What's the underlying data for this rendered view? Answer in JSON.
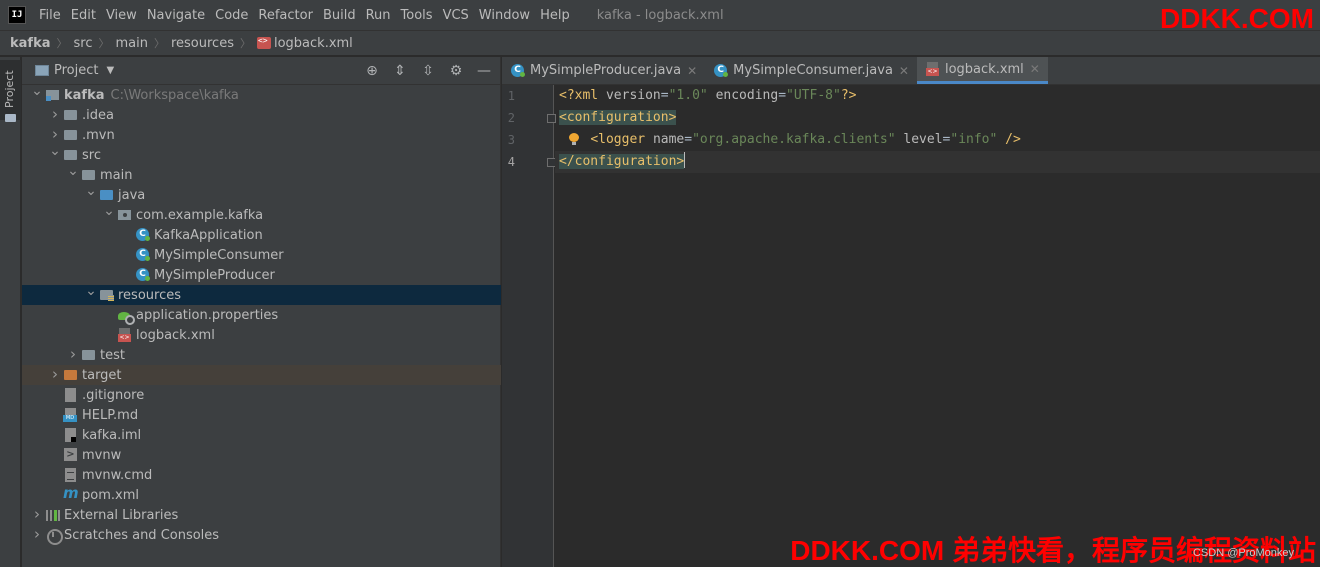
{
  "menubar": {
    "logo_text": "IJ",
    "items": [
      "File",
      "Edit",
      "View",
      "Navigate",
      "Code",
      "Refactor",
      "Build",
      "Run",
      "Tools",
      "VCS",
      "Window",
      "Help"
    ],
    "window_title": "kafka - logback.xml"
  },
  "watermark": {
    "top": "DDKK.COM",
    "bottom": "DDKK.COM 弟弟快看，程序员编程资料站",
    "csdn": "CSDN @ProMonkey"
  },
  "breadcrumb": [
    "kafka",
    "src",
    "main",
    "resources",
    "logback.xml"
  ],
  "toolstrip": {
    "project_label": "Project"
  },
  "project_panel": {
    "title": "Project",
    "tools": [
      "locate-icon",
      "expand-all-icon",
      "collapse-all-icon",
      "gear-icon",
      "minimize-icon"
    ]
  },
  "tree": [
    {
      "label": "kafka",
      "hint": "C:\\Workspace\\kafka",
      "depth": 0,
      "arrow": "open",
      "icon": "module",
      "bold": true
    },
    {
      "label": ".idea",
      "depth": 1,
      "arrow": "closed",
      "icon": "folder"
    },
    {
      "label": ".mvn",
      "depth": 1,
      "arrow": "closed",
      "icon": "folder"
    },
    {
      "label": "src",
      "depth": 1,
      "arrow": "open",
      "icon": "folder"
    },
    {
      "label": "main",
      "depth": 2,
      "arrow": "open",
      "icon": "folder"
    },
    {
      "label": "java",
      "depth": 3,
      "arrow": "open",
      "icon": "folder-blue"
    },
    {
      "label": "com.example.kafka",
      "depth": 4,
      "arrow": "open",
      "icon": "package"
    },
    {
      "label": "KafkaApplication",
      "depth": 5,
      "arrow": "none",
      "icon": "java-class"
    },
    {
      "label": "MySimpleConsumer",
      "depth": 5,
      "arrow": "none",
      "icon": "java-class"
    },
    {
      "label": "MySimpleProducer",
      "depth": 5,
      "arrow": "none",
      "icon": "java-class"
    },
    {
      "label": "resources",
      "depth": 3,
      "arrow": "open",
      "icon": "folder-res",
      "state": "selected"
    },
    {
      "label": "application.properties",
      "depth": 4,
      "arrow": "none",
      "icon": "props"
    },
    {
      "label": "logback.xml",
      "depth": 4,
      "arrow": "none",
      "icon": "xml"
    },
    {
      "label": "test",
      "depth": 2,
      "arrow": "closed",
      "icon": "folder"
    },
    {
      "label": "target",
      "depth": 1,
      "arrow": "closed",
      "icon": "folder-orange",
      "state": "excluded"
    },
    {
      "label": ".gitignore",
      "depth": 1,
      "arrow": "none",
      "icon": "file-gray"
    },
    {
      "label": "HELP.md",
      "depth": 1,
      "arrow": "none",
      "icon": "file-md"
    },
    {
      "label": "kafka.iml",
      "depth": 1,
      "arrow": "none",
      "icon": "file-iml"
    },
    {
      "label": "mvnw",
      "depth": 1,
      "arrow": "none",
      "icon": "shell"
    },
    {
      "label": "mvnw.cmd",
      "depth": 1,
      "arrow": "none",
      "icon": "cmd"
    },
    {
      "label": "pom.xml",
      "depth": 1,
      "arrow": "none",
      "icon": "maven"
    },
    {
      "label": "External Libraries",
      "depth": 0,
      "arrow": "closed",
      "icon": "libs"
    },
    {
      "label": "Scratches and Consoles",
      "depth": 0,
      "arrow": "closed",
      "icon": "scratch"
    }
  ],
  "editor_tabs": [
    {
      "label": "MySimpleProducer.java",
      "icon": "java-class",
      "active": false
    },
    {
      "label": "MySimpleConsumer.java",
      "icon": "java-class",
      "active": false
    },
    {
      "label": "logback.xml",
      "icon": "xml",
      "active": true
    }
  ],
  "editor": {
    "line_numbers": [
      "1",
      "2",
      "3",
      "4"
    ],
    "current_line": 4,
    "lines": [
      [
        {
          "t": "<?xml ",
          "c": "c-tag"
        },
        {
          "t": "version",
          "c": "c-attr"
        },
        {
          "t": "=",
          "c": "c-plain"
        },
        {
          "t": "\"1.0\"",
          "c": "c-val"
        },
        {
          "t": " ",
          "c": "c-plain"
        },
        {
          "t": "encoding",
          "c": "c-attr"
        },
        {
          "t": "=",
          "c": "c-plain"
        },
        {
          "t": "\"UTF-8\"",
          "c": "c-val"
        },
        {
          "t": "?>",
          "c": "c-tag"
        }
      ],
      [
        {
          "t": "<configuration>",
          "c": "c-tag c-hl"
        }
      ],
      [
        {
          "t": "    ",
          "c": "c-plain"
        },
        {
          "t": "<logger ",
          "c": "c-tag"
        },
        {
          "t": "name",
          "c": "c-attr"
        },
        {
          "t": "=",
          "c": "c-plain"
        },
        {
          "t": "\"org.apache.kafka.clients\"",
          "c": "c-val"
        },
        {
          "t": " ",
          "c": "c-plain"
        },
        {
          "t": "level",
          "c": "c-attr"
        },
        {
          "t": "=",
          "c": "c-plain"
        },
        {
          "t": "\"info\"",
          "c": "c-val"
        },
        {
          "t": " ",
          "c": "c-plain"
        },
        {
          "t": "/>",
          "c": "c-tag"
        }
      ],
      [
        {
          "t": "</configuration>",
          "c": "c-tag c-hl"
        }
      ]
    ]
  }
}
